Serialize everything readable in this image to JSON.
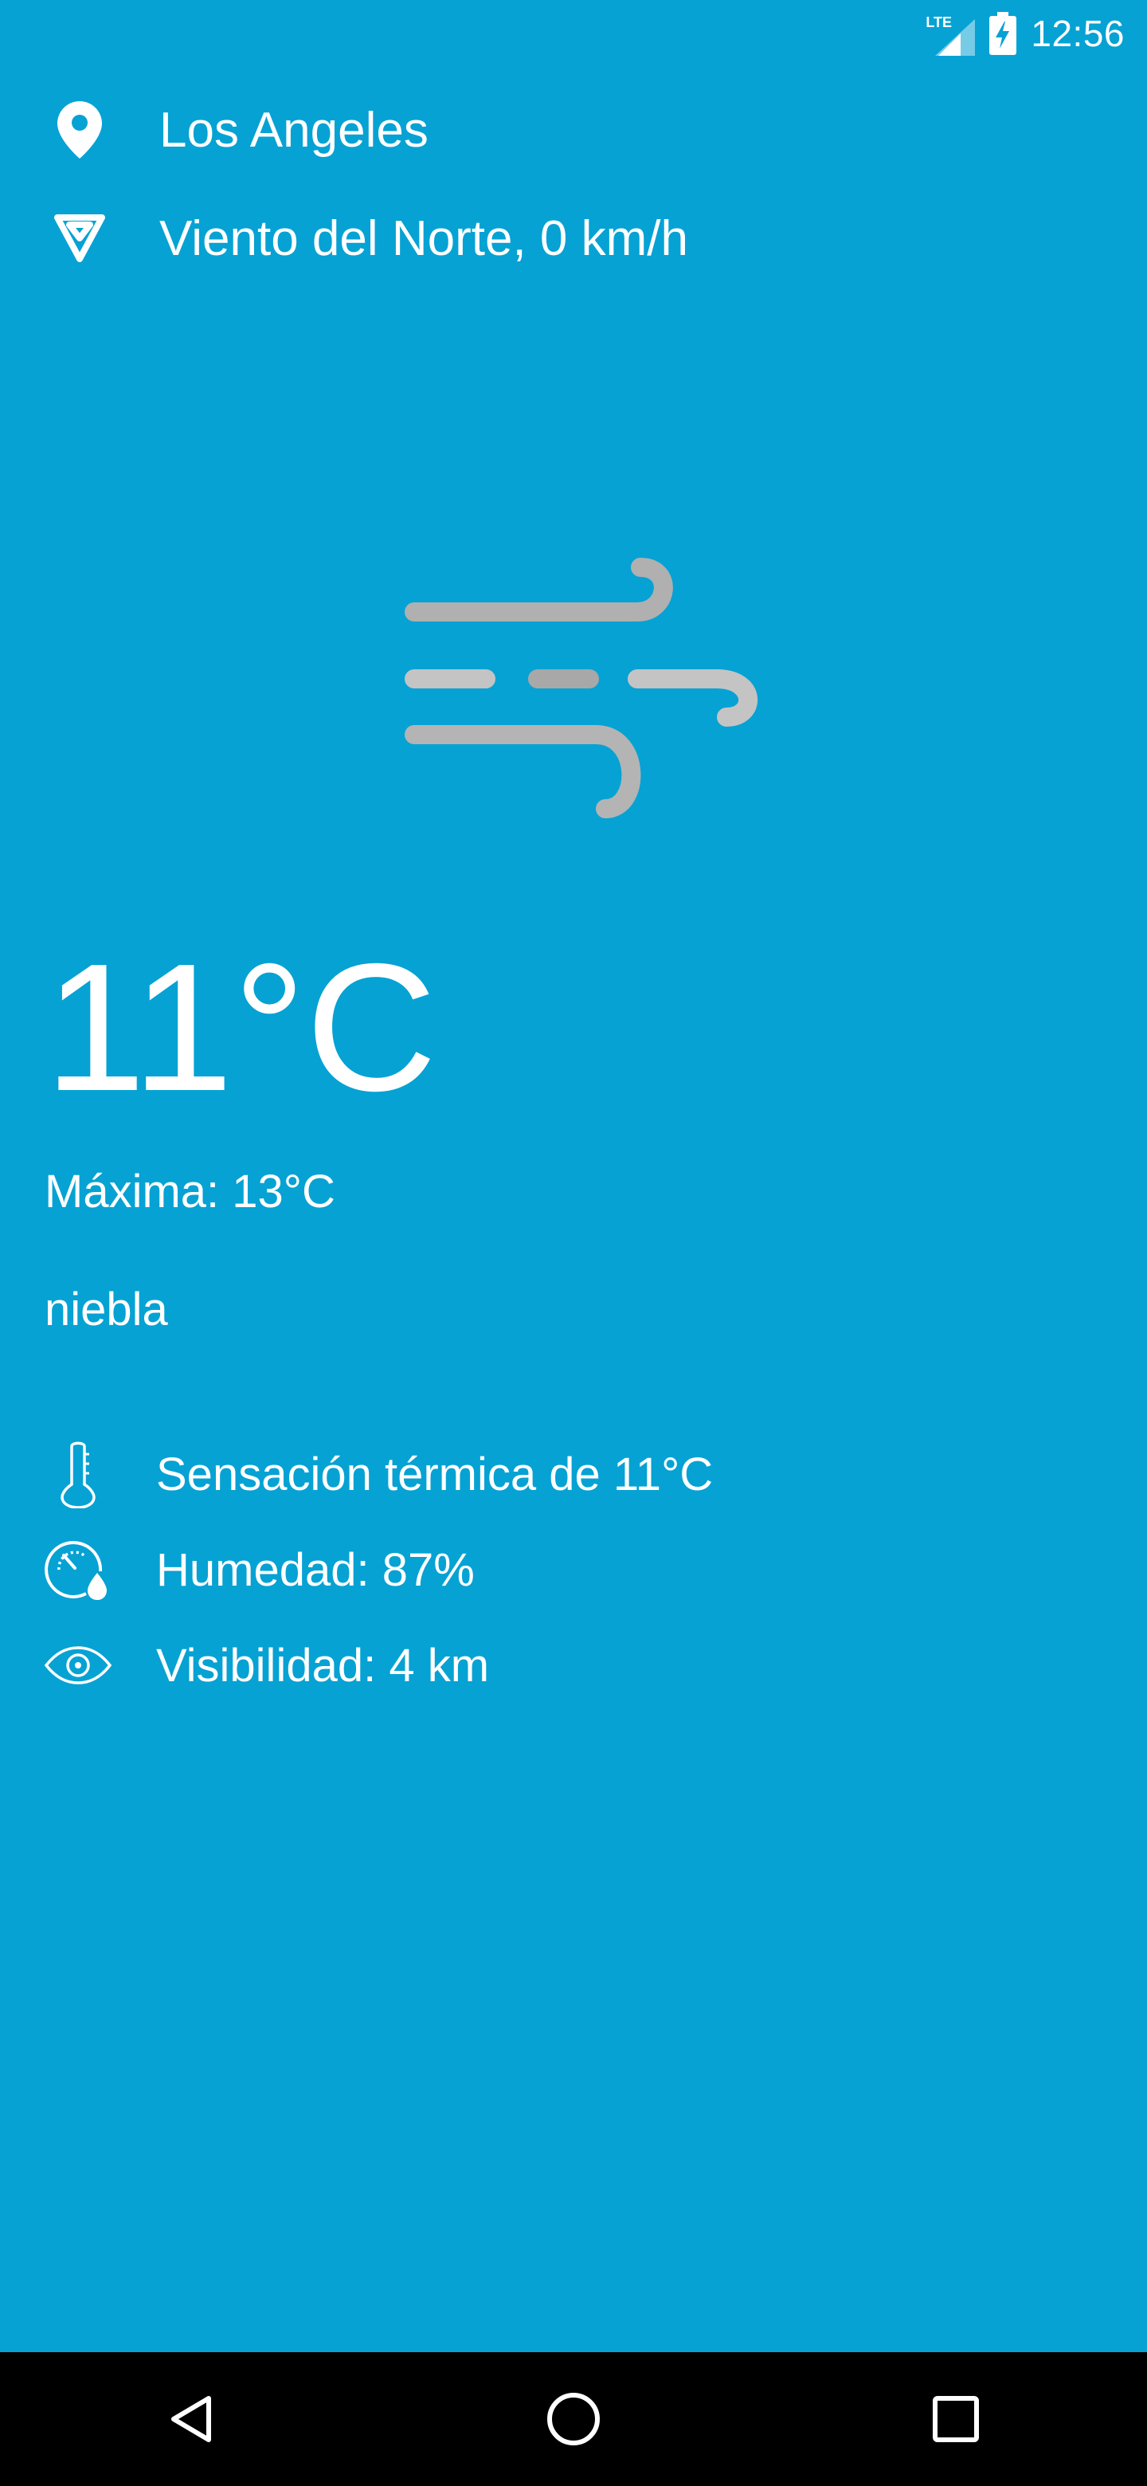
{
  "status_bar": {
    "network_label": "LTE",
    "time": "12:56",
    "icons": [
      "lte-signal-icon",
      "battery-charging-icon"
    ]
  },
  "location": {
    "city": "Los Angeles",
    "icon": "location-pin-icon"
  },
  "wind": {
    "text": "Viento del Norte, 0 km/h",
    "icon": "wind-direction-icon"
  },
  "weather": {
    "icon": "wind-fog-icon",
    "temperature": "11°C",
    "max_temp": "Máxima: 13°C",
    "condition": "niebla"
  },
  "details": [
    {
      "icon": "thermometer-icon",
      "text": "Sensación térmica de 11°C"
    },
    {
      "icon": "humidity-gauge-icon",
      "text": "Humedad: 87%"
    },
    {
      "icon": "eye-icon",
      "text": "Visibilidad: 4 km"
    }
  ],
  "nav": {
    "buttons": [
      "back-icon",
      "home-icon",
      "recents-icon"
    ]
  },
  "colors": {
    "background": "#06a2d4",
    "nav_bar": "#000000",
    "text": "#ffffff",
    "weather_icon_gray": "#b4b4b4"
  }
}
